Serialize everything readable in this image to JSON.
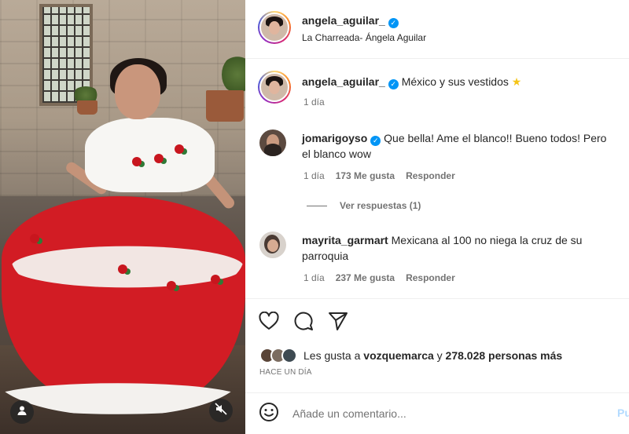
{
  "header": {
    "username": "angela_aguilar_",
    "subtitle": "La Charreada- Ángela Aguilar"
  },
  "caption": {
    "username": "angela_aguilar_",
    "text": "México y sus vestidos",
    "time": "1 día"
  },
  "comments": [
    {
      "username": "jomarigoyso",
      "verified": true,
      "text_line1": "Que bella! Ame el blanco!! Bueno todos! Pero",
      "text_line2": "el blanco wow",
      "time": "1 día",
      "likes": "173 Me gusta",
      "reply": "Responder",
      "view_replies": "Ver respuestas (1)"
    },
    {
      "username": "mayrita_garmart",
      "verified": false,
      "text_line1": "Mexicana al 100 no niega la cruz de su",
      "text_line2": "parroquia",
      "time": "1 día",
      "likes": "237 Me gusta",
      "reply": "Responder"
    }
  ],
  "likes_summary": {
    "prefix": "Les gusta a",
    "user": "vozquemarca",
    "conjunction": "y",
    "rest": "278.028 personas más"
  },
  "timestamp": "HACE UN DÍA",
  "add_comment": {
    "placeholder": "Añade un comentario...",
    "post_label": "Pu"
  },
  "icons": {
    "like": "heart-icon",
    "comment": "comment-bubble-icon",
    "share": "paper-plane-icon",
    "emoji": "smiley-icon",
    "user_tag": "user-icon",
    "mute": "speaker-muted-icon",
    "caption_emoji": "star-emoji"
  },
  "colors": {
    "verified": "#0095f6",
    "link_blue": "#0095f6",
    "secondary_text": "#737373",
    "divider": "#efefef"
  }
}
